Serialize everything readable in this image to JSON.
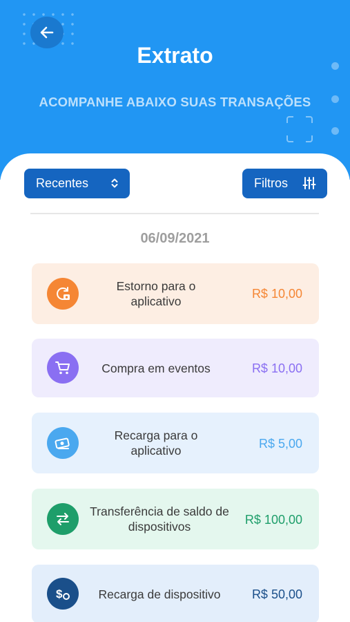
{
  "header": {
    "title": "Extrato",
    "subtitle": "ACOMPANHE ABAIXO SUAS TRANSAÇÕES",
    "back_icon": "arrow-left-icon",
    "background_color": "#2196f3"
  },
  "controls": {
    "sort_label": "Recentes",
    "sort_icon": "chevron-up-down-icon",
    "filter_label": "Filtros",
    "filter_icon": "sliders-icon"
  },
  "date": "06/09/2021",
  "transactions": [
    {
      "label": "Estorno para o aplicativo",
      "amount": "R$ 10,00",
      "icon": "refund-icon",
      "bg": "#fdeee3",
      "accent": "#f58634"
    },
    {
      "label": "Compra em eventos",
      "amount": "R$ 10,00",
      "icon": "cart-icon",
      "bg": "#efecfd",
      "accent": "#8a6ff2"
    },
    {
      "label": "Recarga para o aplicativo",
      "amount": "R$ 5,00",
      "icon": "cash-icon",
      "bg": "#e6f1fd",
      "accent": "#4aa8ef"
    },
    {
      "label": "Transferência de saldo de dispositivos",
      "amount": "R$ 100,00",
      "icon": "transfer-icon",
      "bg": "#e4f7ee",
      "accent": "#1e9e6a"
    },
    {
      "label": "Recarga de dispositivo",
      "amount": "R$ 50,00",
      "icon": "dollar-device-icon",
      "bg": "#e3eefb",
      "accent": "#1a4f8a"
    }
  ]
}
